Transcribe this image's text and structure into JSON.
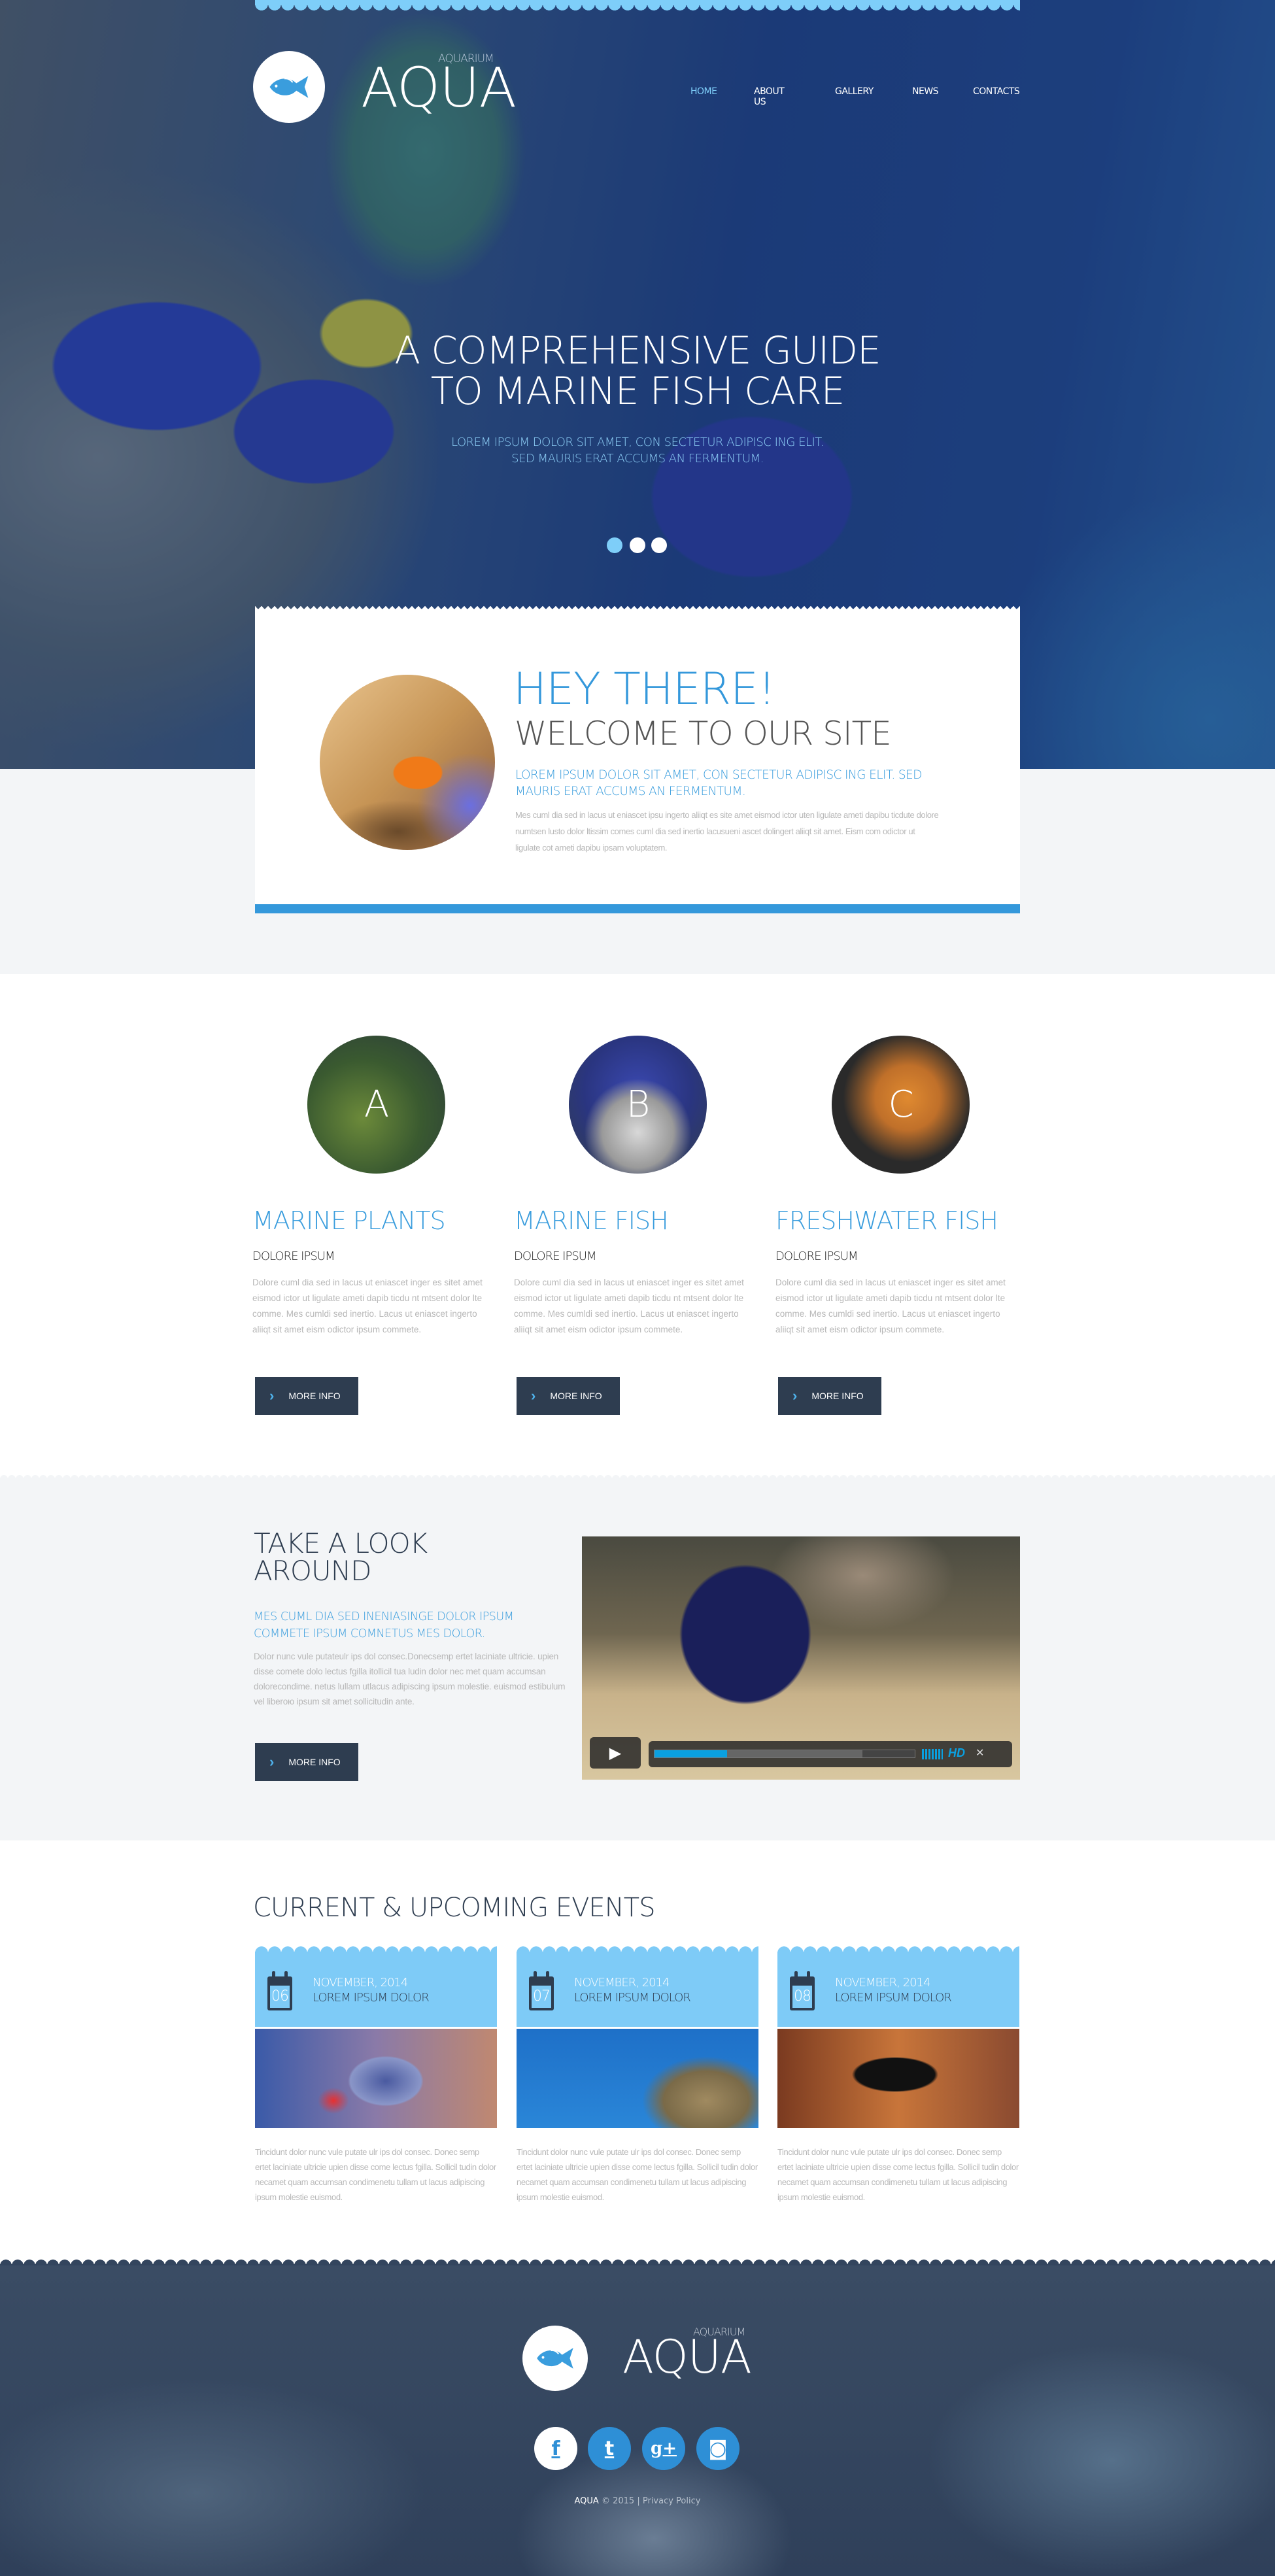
{
  "colors": {
    "accent": "#3498db",
    "light_blue": "#7ecbf7",
    "dark_button": "#2e3d50"
  },
  "header": {
    "logo": {
      "small": "AQUARIUM",
      "big": "AQUA",
      "icon": "fish-icon"
    },
    "nav": [
      {
        "label": "HOME",
        "active": true
      },
      {
        "label": "ABOUT US"
      },
      {
        "label": "GALLERY"
      },
      {
        "label": "NEWS"
      },
      {
        "label": "CONTACTS"
      }
    ]
  },
  "hero": {
    "title_line1": "A COMPREHENSIVE GUIDE",
    "title_line2": "TO MARINE FISH CARE",
    "sub_line1": "LOREM IPSUM DOLOR SIT AMET, CON SECTETUR ADIPISC ING ELIT.",
    "sub_line2": "SED MAURIS ERAT ACCUMS AN FERMENTUM.",
    "slides": 3,
    "active_slide": 1
  },
  "welcome": {
    "heading": "HEY THERE!",
    "subheading": "WELCOME TO OUR SITE",
    "lead": "LOREM IPSUM DOLOR SIT AMET, CON SECTETUR ADIPISC ING ELIT. SED MAURIS ERAT ACCUMS AN FERMENTUM.",
    "body": "Mes cuml dia sed in lacus ut eniascet ipsu ingerto aliiqt es site amet eismod ictor uten ligulate ameti dapibu ticdute dolore numtsen lusto dolor ltissim comes cuml dia sed inertio lacusueni ascet dolingert aliiqt sit amet. Eism com odictor ut ligulate cot ameti dapibu ipsam voluptatem."
  },
  "features": [
    {
      "letter": "A",
      "title": "MARINE PLANTS",
      "subtitle": "DOLORE IPSUM",
      "body": "Dolore cuml dia sed in lacus ut eniascet inger es sitet amet eismod ictor ut ligulate ameti dapib ticdu nt mtsent dolor lte comme. Mes cumldi sed inertio. Lacus ut eniascet ingerto aliiqt sit amet eism odictor ipsum commete.",
      "button": "MORE INFO"
    },
    {
      "letter": "B",
      "title": "MARINE FISH",
      "subtitle": "DOLORE IPSUM",
      "body": "Dolore cuml dia sed in lacus ut eniascet inger es sitet amet eismod ictor ut ligulate ameti dapib ticdu nt mtsent dolor lte comme. Mes cumldi sed inertio. Lacus ut eniascet ingerto aliiqt sit amet eism odictor ipsum commete.",
      "button": "MORE INFO"
    },
    {
      "letter": "C",
      "title": "FRESHWATER FISH",
      "subtitle": "DOLORE IPSUM",
      "body": "Dolore cuml dia sed in lacus ut eniascet inger es sitet amet eismod ictor ut ligulate ameti dapib ticdu nt mtsent dolor lte comme. Mes cumldi sed inertio. Lacus ut eniascet ingerto aliiqt sit amet eism odictor ipsum commete.",
      "button": "MORE INFO"
    }
  ],
  "look": {
    "title_line1": "TAKE A LOOK",
    "title_line2": "AROUND",
    "lead": "MES CUML DIA SED INENIASINGE DOLOR IPSUM COMMETE IPSUM COMNETUS MES DOLOR.",
    "body": "Dolor nunc vule putateulr ips dol consec.Donecsemp ertet laciniate ultricie. upien disse comete dolo lectus fgilla itollicil tua ludin dolor nec met quam accumsan dolorecondime. netus lullam utlacus adipiscing ipsum molestie. euismod estibulum vel liberoю ipsum sit amet sollicitudin ante.",
    "button": "MORE INFO",
    "video": {
      "progress": 0.28,
      "buffered": 0.8,
      "hd_label": "HD"
    }
  },
  "events": {
    "title": "CURRENT & UPCOMING EVENTS",
    "items": [
      {
        "day": "06",
        "date": "NOVEMBER, 2014",
        "name": "LOREM IPSUM DOLOR",
        "body": "Tincidunt dolor nunc vule putate ulr ips dol consec. Donec semp ertet laciniate ultricie upien disse come lectus fgilla. Sollicil tudin dolor necamet quam accumsan condimenetu tullam ut lacus adipiscing ipsum molestie euismod."
      },
      {
        "day": "07",
        "date": "NOVEMBER, 2014",
        "name": "LOREM IPSUM DOLOR",
        "body": "Tincidunt dolor nunc vule putate ulr ips dol consec. Donec semp ertet laciniate ultricie upien disse come lectus fgilla. Sollicil tudin dolor necamet quam accumsan condimenetu tullam ut lacus adipiscing ipsum molestie euismod."
      },
      {
        "day": "08",
        "date": "NOVEMBER, 2014",
        "name": "LOREM IPSUM DOLOR",
        "body": "Tincidunt dolor nunc vule putate ulr ips dol consec. Donec semp ertet laciniate ultricie upien disse come lectus fgilla. Sollicil tudin dolor necamet quam accumsan condimenetu tullam ut lacus adipiscing ipsum molestie euismod."
      }
    ]
  },
  "footer": {
    "logo": {
      "small": "AQUARIUM",
      "big": "AQUA"
    },
    "social": [
      {
        "icon": "facebook-icon",
        "glyph": "f"
      },
      {
        "icon": "twitter-icon",
        "glyph": "t"
      },
      {
        "icon": "google-plus-icon",
        "glyph": "g+"
      },
      {
        "icon": "instagram-icon",
        "glyph": "◙"
      }
    ],
    "brand": "AQUA",
    "copyright": "© 2015",
    "separator": "|",
    "privacy": "Privacy Policy"
  }
}
